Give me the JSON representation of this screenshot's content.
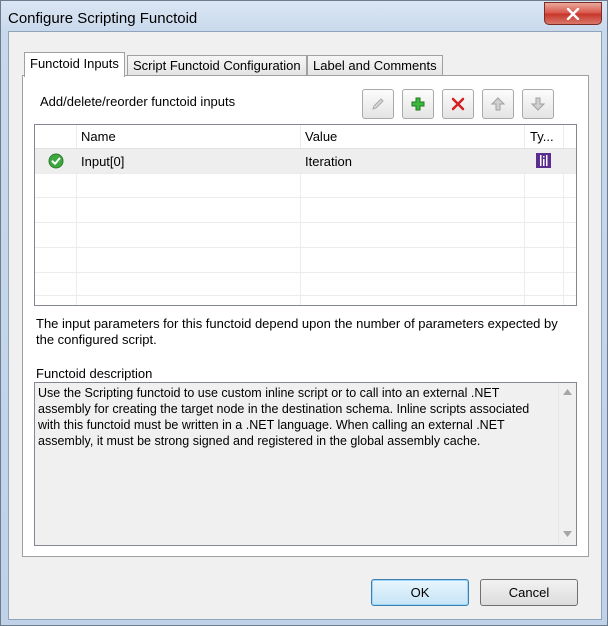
{
  "window": {
    "title": "Configure Scripting Functoid"
  },
  "tabs": [
    {
      "label": "Functoid Inputs"
    },
    {
      "label": "Script Functoid Configuration"
    },
    {
      "label": "Label and Comments"
    }
  ],
  "panel": {
    "caption": "Add/delete/reorder functoid inputs"
  },
  "toolbar": {
    "edit_icon": "pencil-icon",
    "add_icon": "green-plus-icon",
    "delete_icon": "red-x-icon",
    "move_up_icon": "up-arrow-icon",
    "move_down_icon": "down-arrow-icon"
  },
  "grid": {
    "columns": [
      "Name",
      "Value",
      "Ty..."
    ],
    "rows": [
      {
        "status_icon": "green-check-icon",
        "name": "Input[0]",
        "value": "Iteration",
        "type_icon": "iteration-type-icon"
      }
    ]
  },
  "info_text": "The input parameters for this functoid depend upon the number of parameters expected by the configured script.",
  "description": {
    "label": "Functoid description",
    "text": "Use the Scripting functoid to use custom inline script or to call into an external .NET assembly for creating the target node in the destination schema. Inline scripts associated with this functoid must be written in a .NET language. When calling an external .NET assembly, it must be strong signed and registered in the global assembly cache."
  },
  "buttons": {
    "ok": "OK",
    "cancel": "Cancel"
  },
  "colors": {
    "accent": "#3c7fb1",
    "close_red": "#c7352a",
    "add_green": "#2e9e2e",
    "delete_red": "#d42020",
    "type_purple": "#5c2d91"
  }
}
